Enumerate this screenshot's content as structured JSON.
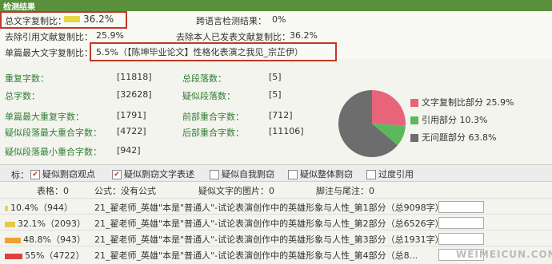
{
  "header": {
    "title": "检测结果"
  },
  "summary": {
    "total_copy_label": "总文字复制比：",
    "total_copy_value": "36.2%",
    "cross_lang_label": "跨语言检测结果：",
    "cross_lang_value": "0%",
    "exclude_ref_label": "去除引用文献复制比：",
    "exclude_ref_value": "25.9%",
    "exclude_self_label": "去除本人已发表文献复制比：",
    "exclude_self_value": "36.2%",
    "single_max_label": "单篇最大文字复制比：",
    "single_max_value": "5.5%（【陈坤毕业论文】性格化表演之我见_宗芷伊）"
  },
  "stats": {
    "total_chars_label": "重复字数：",
    "total_chars_value": "[11818]",
    "total_paras_label": "总段落数：",
    "total_paras_value": "[5]",
    "chars_label": "总字数：",
    "chars_value": "[32628]",
    "suspect_paras_label": "疑似段落数：",
    "suspect_paras_value": "[5]",
    "single_max_dup_label": "单篇最大重复字数：",
    "single_max_dup_value": "[1791]",
    "front_dup_label": "前部重合字数：",
    "front_dup_value": "[712]",
    "suspect_para_max_label": "疑似段落最大重合字数：",
    "suspect_para_max_value": "[4722]",
    "back_dup_label": "后部重合字数：",
    "back_dup_value": "[11106]",
    "suspect_para_min_label": "疑似段落最小重合字数：",
    "suspect_para_min_value": "[942]"
  },
  "chart_data": {
    "type": "pie",
    "categories": [
      "文字复制比部分",
      "引用部分",
      "无问题部分"
    ],
    "values": [
      25.9,
      10.3,
      63.8
    ],
    "legend_labels": [
      "文字复制比部分 25.9%",
      "引用部分 10.3%",
      "无问题部分 63.8%"
    ],
    "colors": [
      "#e8647a",
      "#5cb85c",
      "#6d6d6d"
    ],
    "legend_position": "right"
  },
  "filters": {
    "prefix": "标：",
    "items": [
      {
        "label": "疑似剽窃观点",
        "checked": true
      },
      {
        "label": "疑似剽窃文字表述",
        "checked": true
      },
      {
        "label": "疑似自我剽窃",
        "checked": false
      },
      {
        "label": "疑似整体剽窃",
        "checked": false
      },
      {
        "label": "过度引用",
        "checked": false
      }
    ]
  },
  "counts": {
    "tables": "表格：0",
    "formulas": "公式：没有公式",
    "images": "疑似文字的图片：0",
    "footnotes": "脚注与尾注：0"
  },
  "results": [
    {
      "pct": "10.4%（944）",
      "fill": 0.104,
      "name": "21_翟老师_英雄\"本是\"普通人\"-试论表演创作中的英雄形象与人性_第1部分（总9098字）"
    },
    {
      "pct": "32.1%（2093）",
      "fill": 0.321,
      "name": "21_翟老师_英雄\"本是\"普通人\"-试论表演创作中的英雄形象与人性_第2部分（总6526字）"
    },
    {
      "pct": "48.8%（943）",
      "fill": 0.488,
      "name": "21_翟老师_英雄\"本是\"普通人\"-试论表演创作中的英雄形象与人性_第3部分（总1931字）"
    },
    {
      "pct": "55%（4722）",
      "fill": 0.55,
      "name": "21_翟老师_英雄\"本是\"普通人\"-试论表演创作中的英雄形象与人性_第4部分（总8..."
    }
  ],
  "watermark": "WEIMEICUN.COM"
}
